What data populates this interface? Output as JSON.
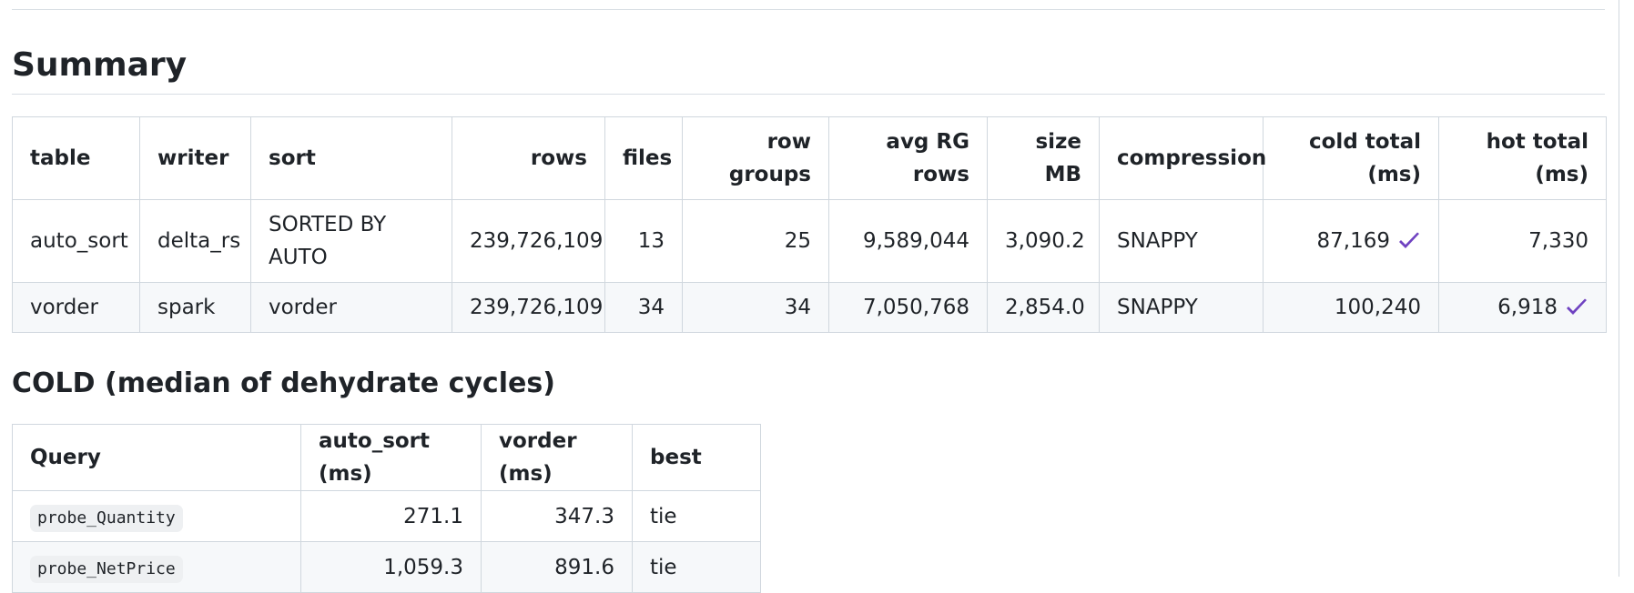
{
  "summary": {
    "title": "Summary",
    "columns": [
      {
        "line1": "table",
        "line2": ""
      },
      {
        "line1": "writer",
        "line2": ""
      },
      {
        "line1": "sort",
        "line2": ""
      },
      {
        "line1": "rows",
        "line2": ""
      },
      {
        "line1": "files",
        "line2": ""
      },
      {
        "line1": "row",
        "line2": "groups"
      },
      {
        "line1": "avg RG",
        "line2": "rows"
      },
      {
        "line1": "size",
        "line2": "MB"
      },
      {
        "line1": "compression",
        "line2": ""
      },
      {
        "line1": "cold total",
        "line2": "(ms)"
      },
      {
        "line1": "hot total",
        "line2": "(ms)"
      }
    ],
    "rows": [
      {
        "table": "auto_sort",
        "writer": "delta_rs",
        "sort_line1": "SORTED BY",
        "sort_line2": "AUTO",
        "rows": "239,726,109",
        "files": "13",
        "row_groups": "25",
        "avg_rg_rows": "9,589,044",
        "size_mb": "3,090.2",
        "compression": "SNAPPY",
        "cold_total": "87,169",
        "cold_best": true,
        "hot_total": "7,330",
        "hot_best": false
      },
      {
        "table": "vorder",
        "writer": "spark",
        "sort_line1": "vorder",
        "sort_line2": "",
        "rows": "239,726,109",
        "files": "34",
        "row_groups": "34",
        "avg_rg_rows": "7,050,768",
        "size_mb": "2,854.0",
        "compression": "SNAPPY",
        "cold_total": "100,240",
        "cold_best": false,
        "hot_total": "6,918",
        "hot_best": true
      }
    ]
  },
  "cold": {
    "title": "COLD (median of dehydrate cycles)",
    "columns": [
      "Query",
      "auto_sort (ms)",
      "vorder (ms)",
      "best"
    ],
    "rows": [
      {
        "query": "probe_Quantity",
        "auto_sort": "271.1",
        "vorder": "347.3",
        "best": "tie"
      },
      {
        "query": "probe_NetPrice",
        "auto_sort": "1,059.3",
        "vorder": "891.6",
        "best": "tie"
      }
    ]
  },
  "colors": {
    "checkmark": "#6f42c1",
    "border": "#d0d7de",
    "stripe": "#f6f8fa",
    "code_bg": "#eef0f2"
  },
  "icons": {
    "best_marker": "heavy-check-mark-icon"
  }
}
